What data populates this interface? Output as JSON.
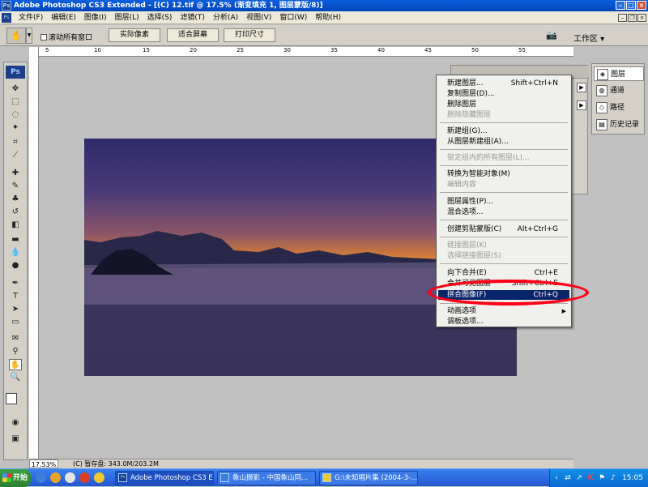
{
  "window": {
    "title": "Adobe Photoshop CS3 Extended - [(C) 12.tif @ 17.5% (渐变填充 1, 图层蒙版/8)]",
    "ps_badge": "Ps"
  },
  "menu": [
    "文件(F)",
    "编辑(E)",
    "图像(I)",
    "图层(L)",
    "选择(S)",
    "滤镜(T)",
    "分析(A)",
    "视图(V)",
    "窗口(W)",
    "帮助(H)"
  ],
  "options_bar": {
    "scroll_all_windows": "滚动所有窗口",
    "btn_actual_pixels": "实际像素",
    "btn_fit_screen": "适合屏幕",
    "btn_print_size": "打印尺寸",
    "workspace": "工作区 ▾"
  },
  "ruler": {
    "h_labels": [
      "5",
      "10",
      "15",
      "20",
      "25",
      "30",
      "35",
      "40",
      "45",
      "50",
      "55"
    ]
  },
  "statusbar": {
    "zoom": "17.53%",
    "info": "(C) 暂存盘: 343.0M/203.2M"
  },
  "dock": {
    "layers": "图层",
    "channels": "通道",
    "paths": "路径",
    "history": "历史记录"
  },
  "context_menu": {
    "items": [
      {
        "label": "新建图层...",
        "shortcut": "Shift+Ctrl+N",
        "disabled": false
      },
      {
        "label": "复制图层(D)...",
        "shortcut": "",
        "disabled": false
      },
      {
        "label": "删除图层",
        "shortcut": "",
        "disabled": false
      },
      {
        "label": "删除隐藏图层",
        "shortcut": "",
        "disabled": true
      },
      {
        "label": "新建组(G)...",
        "shortcut": "",
        "disabled": false
      },
      {
        "label": "从图层新建组(A)...",
        "shortcut": "",
        "disabled": false
      },
      {
        "label": "锁定组内的所有图层(L)...",
        "shortcut": "",
        "disabled": true
      },
      {
        "label": "转换为智能对象(M)",
        "shortcut": "",
        "disabled": false
      },
      {
        "label": "编辑内容",
        "shortcut": "",
        "disabled": true
      },
      {
        "label": "图层属性(P)...",
        "shortcut": "",
        "disabled": false
      },
      {
        "label": "混合选项...",
        "shortcut": "",
        "disabled": false
      },
      {
        "label": "创建剪贴蒙版(C)",
        "shortcut": "Alt+Ctrl+G",
        "disabled": false
      },
      {
        "label": "链接图层(K)",
        "shortcut": "",
        "disabled": true
      },
      {
        "label": "选择链接图层(S)",
        "shortcut": "",
        "disabled": true
      },
      {
        "label": "向下合并(E)",
        "shortcut": "Ctrl+E",
        "disabled": false
      },
      {
        "label": "合并可见图层",
        "shortcut": "Shift+Ctrl+E",
        "disabled": false
      },
      {
        "label": "拼合图像(F)",
        "shortcut": "Ctrl+Q",
        "disabled": false,
        "highlighted": true
      },
      {
        "label": "动画选项",
        "shortcut": "",
        "disabled": false,
        "submenu": true
      },
      {
        "label": "调板选项...",
        "shortcut": "",
        "disabled": false
      }
    ]
  },
  "taskbar": {
    "start": "开始",
    "tasks": [
      "Adobe Photoshop CS3 E...",
      "象山摄影 - 中国象山同...",
      "G:\\未知唱片集 (2004-3-..."
    ],
    "time": "15:05"
  },
  "colors": {
    "highlight": "#0a246a",
    "annotation_circle": "#ff0018",
    "titlebar": "#0a5fdc"
  }
}
